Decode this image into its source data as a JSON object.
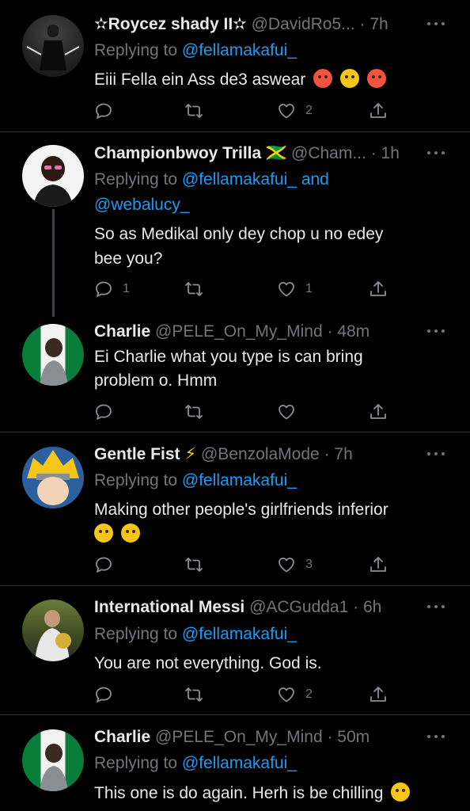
{
  "colors": {
    "background": "#000000",
    "text": "#e7e9ea",
    "muted": "#71767b",
    "link": "#1d9bf0",
    "separator": "#2f3336"
  },
  "icons": {
    "reply": "reply-icon",
    "retweet": "retweet-icon",
    "like": "like-icon",
    "share": "share-icon",
    "more": "more-icon"
  },
  "tweets": [
    {
      "name": "✫Roycez shady II✫",
      "handle": "@DavidRo5...",
      "time": "· 7h",
      "replying_prefix": "Replying to",
      "replying_to": "@fellamakafui_",
      "text": [
        "Eiii Fella ein Ass de3 aswear"
      ],
      "emojis": [
        "hot-face",
        "crying-face",
        "hot-face"
      ],
      "reply_count": "",
      "retweet_count": "",
      "like_count": "2"
    },
    {
      "name": "Championbwoy Trilla 🇯🇲",
      "handle": "@Cham...",
      "time": "· 1h",
      "replying_prefix": "Replying to",
      "replying_to": "@fellamakafui_",
      "replying_and": "and",
      "replying_to_2": "@webalucy_",
      "text": [
        "So as Medikal only dey chop u no edey",
        "bee you?"
      ],
      "reply_count": "1",
      "retweet_count": "",
      "like_count": "1"
    },
    {
      "name": "Charlie",
      "handle": "@PELE_On_My_Mind",
      "time": "· 48m",
      "text": [
        "Ei Charlie what you type is can bring",
        "problem o. Hmm"
      ],
      "reply_count": "",
      "retweet_count": "",
      "like_count": ""
    },
    {
      "name": "Gentle Fist",
      "name_emoji": "⚡",
      "handle": "@BenzolaMode",
      "time": "· 7h",
      "replying_prefix": "Replying to",
      "replying_to": "@fellamakafui_",
      "text": [
        "Making other people's girlfriends inferior"
      ],
      "emojis": [
        "crying-face",
        "crying-face"
      ],
      "reply_count": "",
      "retweet_count": "",
      "like_count": "3"
    },
    {
      "name": "International Messi",
      "handle": "@ACGudda1",
      "time": "· 6h",
      "replying_prefix": "Replying to",
      "replying_to": "@fellamakafui_",
      "text": [
        "You are not everything. God is."
      ],
      "reply_count": "",
      "retweet_count": "",
      "like_count": "2"
    },
    {
      "name": "Charlie",
      "handle": "@PELE_On_My_Mind",
      "time": "· 50m",
      "replying_prefix": "Replying to",
      "replying_to": "@fellamakafui_",
      "text": [
        "This one is do again. Herh is be chilling"
      ],
      "emojis": [
        "laughing-face"
      ]
    }
  ]
}
